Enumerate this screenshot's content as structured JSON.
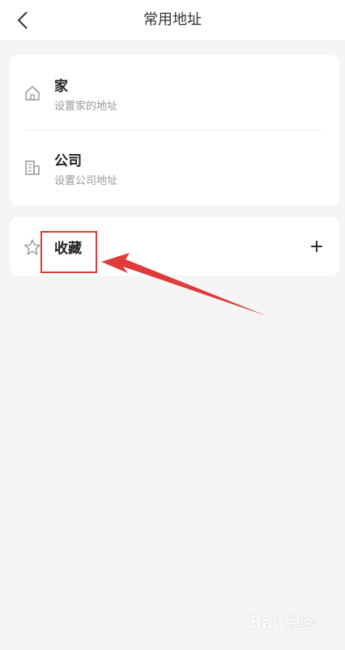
{
  "header": {
    "title": "常用地址",
    "back_icon": "chevron-left-icon"
  },
  "addresses": [
    {
      "title": "家",
      "subtitle": "设置家的地址",
      "icon": "home-icon"
    },
    {
      "title": "公司",
      "subtitle": "设置公司地址",
      "icon": "building-icon"
    }
  ],
  "favorites": {
    "title": "收藏",
    "icon": "star-icon",
    "add_label": "+"
  },
  "annotation": {
    "highlight_color": "#e03a3a"
  },
  "watermark": {
    "text": "Bai 经验"
  }
}
